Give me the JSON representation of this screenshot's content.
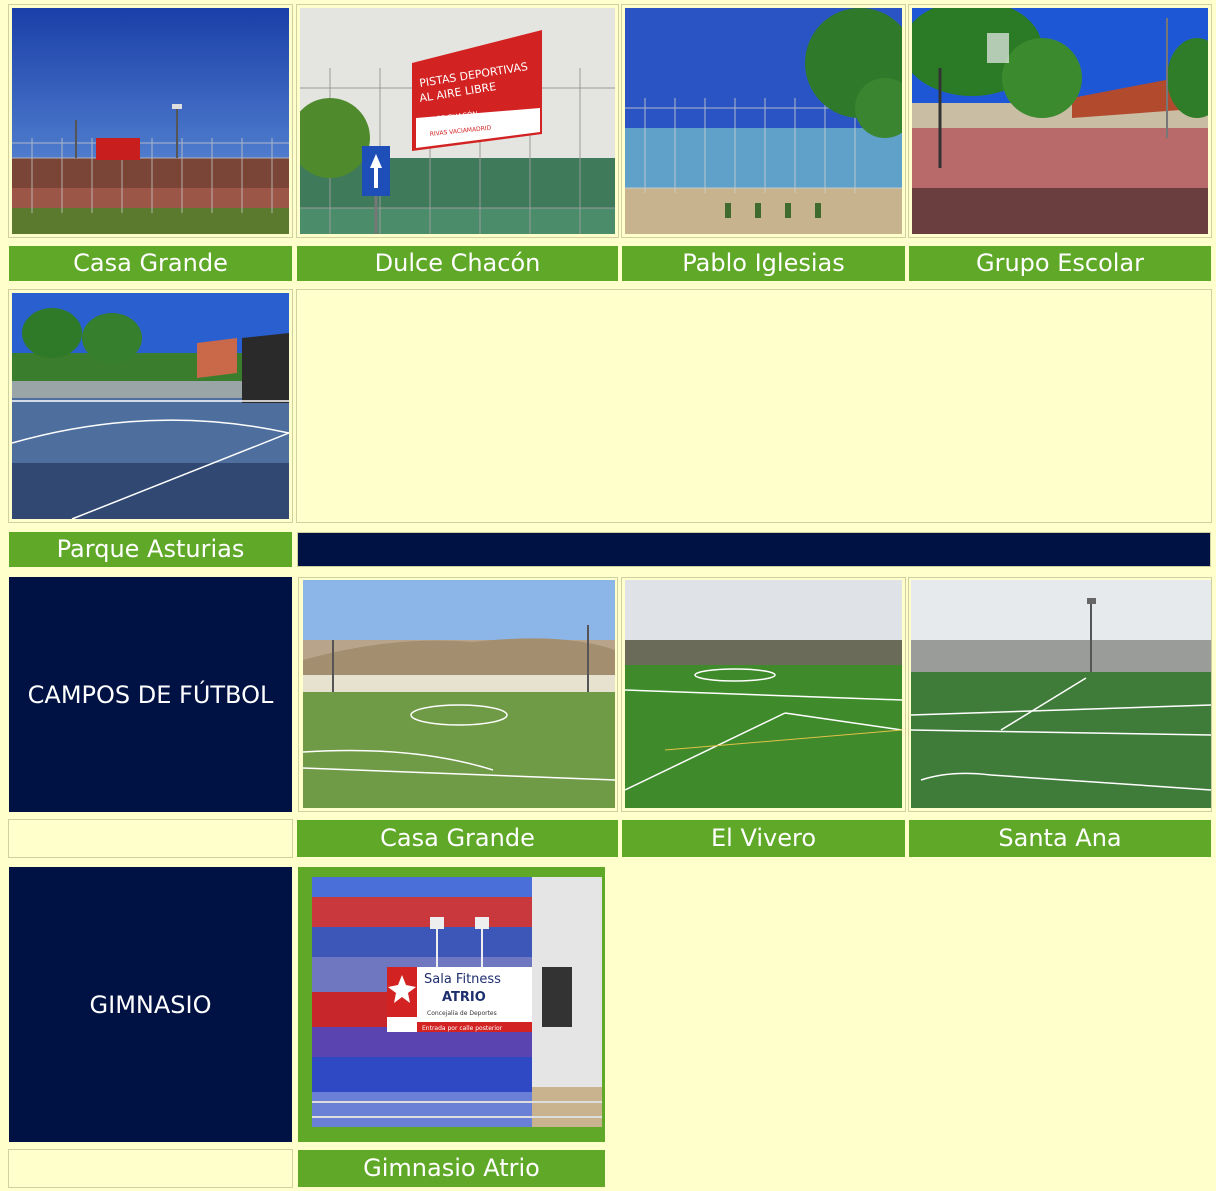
{
  "pistas": {
    "items": [
      {
        "label": "Casa Grande"
      },
      {
        "label": "Dulce Chacón"
      },
      {
        "label": "Pablo Iglesias"
      },
      {
        "label": "Grupo Escolar"
      },
      {
        "label": "Parque Asturias"
      }
    ]
  },
  "dulce_sign": {
    "line1": "PISTAS DEPORTIVAS",
    "line2": "AL AIRE LIBRE",
    "line3": "DULCE CHACÓN",
    "line4": "RIVAS VACIAMADRID"
  },
  "campos": {
    "title": "CAMPOS DE FÚTBOL",
    "items": [
      {
        "label": "Casa Grande"
      },
      {
        "label": "El Vivero"
      },
      {
        "label": "Santa Ana"
      }
    ]
  },
  "gimnasio": {
    "title": "GIMNASIO",
    "items": [
      {
        "label": "Gimnasio Atrio"
      }
    ]
  },
  "atrio_sign": {
    "line1": "Sala Fitness",
    "line2": "ATRIO",
    "line3": "Concejalía de Deportes",
    "line4": "Entrada por calle posterior"
  },
  "colors": {
    "background": "#ffffcc",
    "label_green": "#5fa828",
    "navy": "#001244"
  }
}
